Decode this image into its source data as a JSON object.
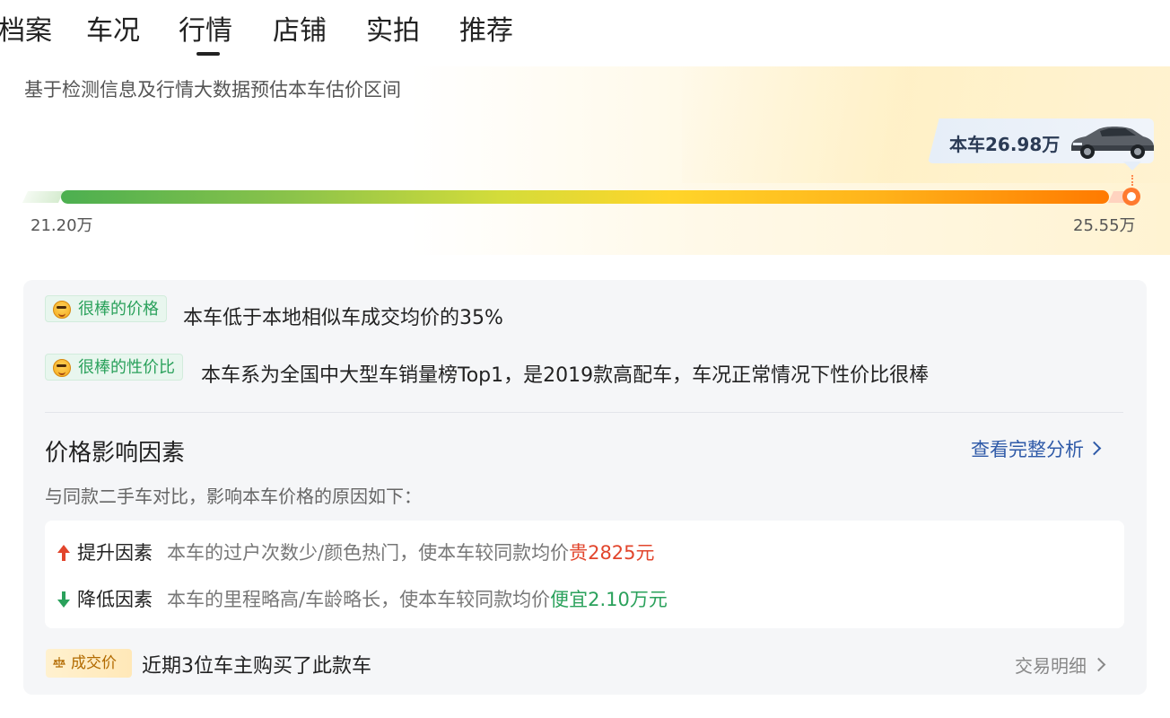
{
  "tabs": [
    "档案",
    "车况",
    "行情",
    "店铺",
    "实拍",
    "推荐"
  ],
  "active_tab": "行情",
  "estimate": {
    "description": "基于检测信息及行情大数据预估本车估价区间",
    "car_price_tag": "本车26.98万",
    "range_min": "21.20万",
    "range_max": "25.55万"
  },
  "comments": [
    {
      "badge": "很棒的价格",
      "text": "本车低于本地相似车成交均价的35%"
    },
    {
      "badge": "很棒的性价比",
      "text": "本车系为全国中大型车销量榜Top1，是2019款高配车，车况正常情况下性价比很棒"
    }
  ],
  "factors": {
    "title": "价格影响因素",
    "full_analysis_link": "查看完整分析",
    "subtitle": "与同款二手车对比，影响本车价格的原因如下：",
    "up": {
      "label": "提升因素",
      "desc": "本车的过户次数少/颜色热门，使本车较同款均价",
      "effect": "贵2825元"
    },
    "down": {
      "label": "降低因素",
      "desc": "本车的里程略高/车龄略长，使本车较同款均价",
      "effect": "便宜2.10万元"
    }
  },
  "deal": {
    "badge": "成交价",
    "text": "近期3位车主购买了此款车",
    "link": "交易明细"
  },
  "colors": {
    "accent_green": "#2aa15b",
    "accent_red": "#e2452c",
    "link_blue": "#2f5aa8",
    "marker_orange": "#ff7a2f"
  }
}
